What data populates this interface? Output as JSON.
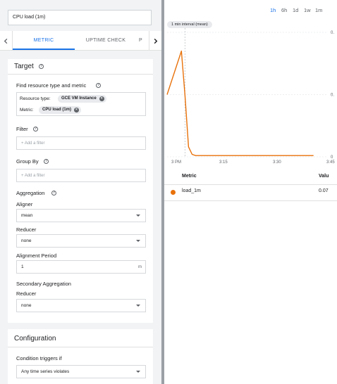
{
  "left_panel": {
    "name_value": "CPU load (1m)",
    "tabs": [
      "METRIC",
      "UPTIME CHECK",
      "P"
    ],
    "target": {
      "title": "Target",
      "find_label": "Find resource type and metric",
      "resource_type_label": "Resource type:",
      "resource_type_value": "GCE VM Instance",
      "metric_label": "Metric:",
      "metric_value": "CPU load (1m)",
      "filter_label": "Filter",
      "filter_placeholder": "+ Add a filter",
      "group_by_label": "Group By",
      "group_by_placeholder": "+ Add a filter",
      "aggregation_label": "Aggregation",
      "aligner_label": "Aligner",
      "aligner_value": "mean",
      "reducer_label": "Reducer",
      "reducer_value": "none",
      "alignment_period_label": "Alignment Period",
      "alignment_period_value": "1",
      "alignment_period_unit": "m",
      "secondary_aggregation_label": "Secondary Aggregation",
      "secondary_reducer_label": "Reducer",
      "secondary_reducer_value": "none"
    },
    "configuration": {
      "title": "Configuration",
      "condition_label": "Condition triggers if",
      "condition_value": "Any time series violates"
    }
  },
  "right_panel": {
    "time_ranges": [
      "1h",
      "6h",
      "1d",
      "1w",
      "1m"
    ],
    "selected_range": "1h",
    "interval_chip": "1 min interval (mean)",
    "table": {
      "headers": [
        "Metric",
        "Valu"
      ],
      "rows": [
        {
          "metric": "load_1m",
          "value": "0.07"
        }
      ]
    },
    "series_color": "#e8710a",
    "accent_color": "#1a73e8"
  },
  "chart_data": {
    "type": "line",
    "x_ticks": [
      "3 PM",
      "3:15",
      "3:30",
      "3:45"
    ],
    "y_ticks": [
      "0.",
      "0.",
      "0"
    ],
    "series": [
      {
        "name": "load_1m",
        "x_min": [
          0,
          4,
          5,
          6,
          7,
          8,
          9,
          10,
          11,
          12,
          13,
          14,
          15,
          16,
          17,
          18,
          19,
          20,
          21,
          22,
          23,
          24,
          25,
          26,
          27,
          28,
          29,
          30,
          31,
          32,
          33,
          34,
          35,
          36,
          37,
          38,
          39,
          40,
          41
        ],
        "values": [
          0.5,
          0.85,
          0.5,
          0.08,
          0.02,
          0.01,
          0.01,
          0.01,
          0.01,
          0.01,
          0.01,
          0.01,
          0.01,
          0.01,
          0.01,
          0.01,
          0.01,
          0.01,
          0.01,
          0.01,
          0.01,
          0.01,
          0.01,
          0.01,
          0.01,
          0.01,
          0.01,
          0.01,
          0.01,
          0.01,
          0.01,
          0.01,
          0.01,
          0.01,
          0.01,
          0.01,
          0.01,
          0.01,
          0.01
        ]
      }
    ]
  }
}
